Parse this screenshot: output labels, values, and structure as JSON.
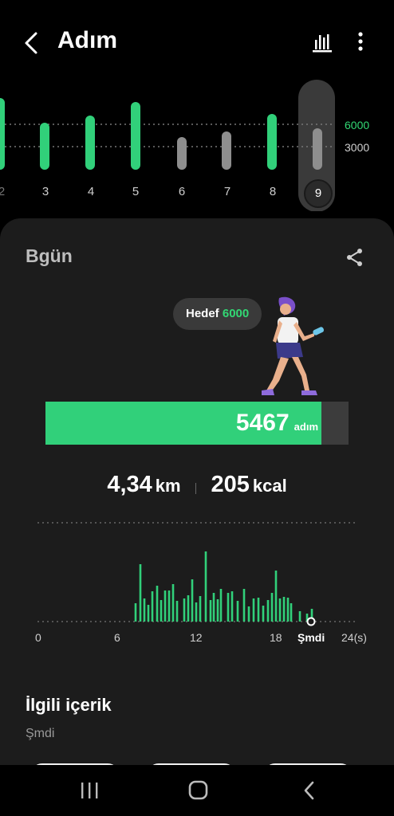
{
  "header": {
    "title": "Adım",
    "back_icon": "chevron-left-icon",
    "stats_icon": "bar-chart-icon",
    "more_icon": "more-vert-icon"
  },
  "daily_chart": {
    "goal_labels": [
      "6000",
      "3000"
    ],
    "days": [
      {
        "label": "2",
        "reached": true
      },
      {
        "label": "3",
        "reached": true
      },
      {
        "label": "4",
        "reached": true
      },
      {
        "label": "5",
        "reached": true
      },
      {
        "label": "6",
        "reached": false
      },
      {
        "label": "7",
        "reached": false
      },
      {
        "label": "8",
        "reached": true
      },
      {
        "label": "9",
        "reached": false
      }
    ],
    "selected_day": "9"
  },
  "card": {
    "title": "Bgün",
    "share_icon": "share-icon",
    "bubble_prefix": "Hedef",
    "bubble_goal": "6000",
    "steps": "5467",
    "steps_unit": "adım",
    "progress_fraction": 0.911,
    "distance": "4,34",
    "distance_unit": "km",
    "calories": "205",
    "calories_unit": "kcal"
  },
  "hourly_chart": {
    "x_labels": [
      "0",
      "6",
      "12",
      "18",
      "Şmdi",
      "24(s)"
    ]
  },
  "related": {
    "title": "İlgili içerik",
    "subtitle": "Şmdi"
  },
  "navbar": {
    "recents_icon": "recents-icon",
    "home_icon": "home-icon",
    "back_icon": "back-icon"
  },
  "colors": {
    "accent": "#31d07a",
    "card_bg": "#1c1c1c",
    "bar_grey": "#8e8e8e"
  }
}
